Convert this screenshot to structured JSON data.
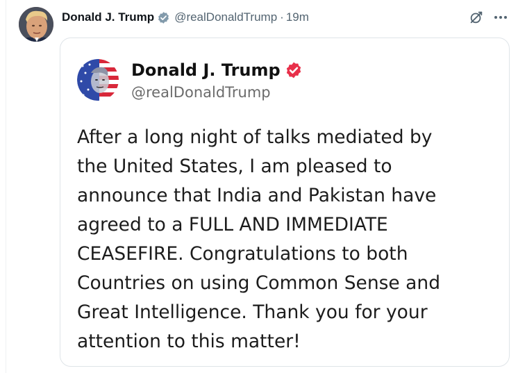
{
  "post": {
    "author_name": "Donald J. Trump",
    "handle": "@realDonaldTrump",
    "separator": "·",
    "time": "19m",
    "icons": {
      "verified": "verified-badge-icon",
      "grok": "grok-icon",
      "more": "more-options-icon"
    }
  },
  "embedded": {
    "author_name": "Donald J. Trump",
    "handle": "@realDonaldTrump",
    "text": "After a long night of talks mediated by\nthe United States, I am pleased to\nannounce that India and Pakistan have\nagreed to a FULL AND IMMEDIATE\nCEASEFIRE. Congratulations to both\nCountries on using Common Sense and\nGreat Intelligence. Thank you for your\nattention to this matter!",
    "icons": {
      "verified": "verified-badge-icon"
    }
  },
  "colors": {
    "verified_gray": "#829aab",
    "verified_red": "#e8304a",
    "secondary_text": "#536471",
    "card_border": "#dfe4e8"
  }
}
